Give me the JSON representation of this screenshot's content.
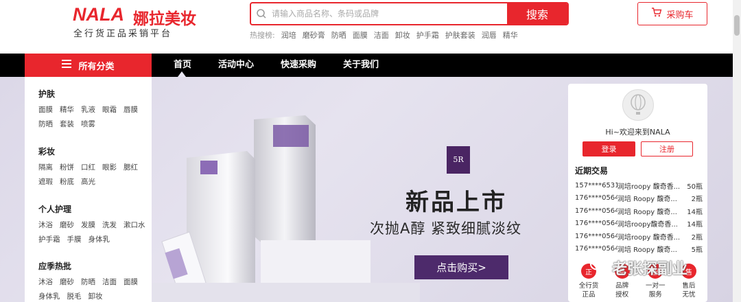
{
  "header": {
    "logo_en": "NALA",
    "logo_cn": "娜拉美妆",
    "tagline": "全行货正品采销平台",
    "search_placeholder": "请输入商品名称、条码或品牌",
    "search_button": "搜索",
    "hot_label": "热搜榜:",
    "hot_words": [
      "润培",
      "磨砂膏",
      "防晒",
      "面膜",
      "洁面",
      "卸妆",
      "护手霜",
      "护肤套装",
      "润唇",
      "精华"
    ],
    "cart_label": "采购车"
  },
  "nav": {
    "all_categories": "所有分类",
    "items": [
      "首页",
      "活动中心",
      "快速采购",
      "关于我们"
    ]
  },
  "sidebar": {
    "categories": [
      {
        "title": "护肤",
        "items": [
          "面膜",
          "精华",
          "乳液",
          "眼霜",
          "唇膜",
          "防晒",
          "套装",
          "喷雾"
        ]
      },
      {
        "title": "彩妆",
        "items": [
          "隔离",
          "粉饼",
          "口红",
          "眼影",
          "腮红",
          "遮瑕",
          "粉底",
          "高光"
        ]
      },
      {
        "title": "个人护理",
        "items": [
          "沐浴",
          "磨砂",
          "发膜",
          "洗发",
          "漱口水",
          "护手霜",
          "手膜",
          "身体乳"
        ]
      },
      {
        "title": "应季热批",
        "items": [
          "沐浴",
          "磨砂",
          "防晒",
          "洁面",
          "面膜",
          "身体乳",
          "脱毛",
          "卸妆"
        ]
      }
    ]
  },
  "banner": {
    "brand_mark": "5R",
    "title": "新品上市",
    "subtitle": "次抛A醇 紧致细腻淡纹",
    "cta": "点击购买>"
  },
  "user_panel": {
    "welcome": "Hi~欢迎来到NALA",
    "login": "登录",
    "register": "注册",
    "transactions_title": "近期交易",
    "transactions": [
      {
        "phone": "157****6531",
        "product": "润培roopy 馥奇香...",
        "qty": "50瓶"
      },
      {
        "phone": "176****0564",
        "product": "润培 Roopy 馥奇...",
        "qty": "2瓶"
      },
      {
        "phone": "176****0564",
        "product": "润培 Roopy 馥奇...",
        "qty": "14瓶"
      },
      {
        "phone": "176****0564",
        "product": "润培roopy馥奇香...",
        "qty": "14瓶"
      },
      {
        "phone": "176****0564",
        "product": "润培roopy 馥奇香...",
        "qty": "2瓶"
      },
      {
        "phone": "176****0564",
        "product": "润培 Roopy 馥奇...",
        "qty": "5瓶"
      }
    ],
    "features": [
      {
        "icon": "正",
        "label_1": "全行货",
        "label_2": "正品"
      },
      {
        "icon": "品",
        "label_1": "品牌",
        "label_2": "授权"
      },
      {
        "icon": "服",
        "label_1": "一对一",
        "label_2": "服务"
      },
      {
        "icon": "售",
        "label_1": "售后",
        "label_2": "无忧"
      }
    ]
  },
  "watermark": "老张探副业"
}
